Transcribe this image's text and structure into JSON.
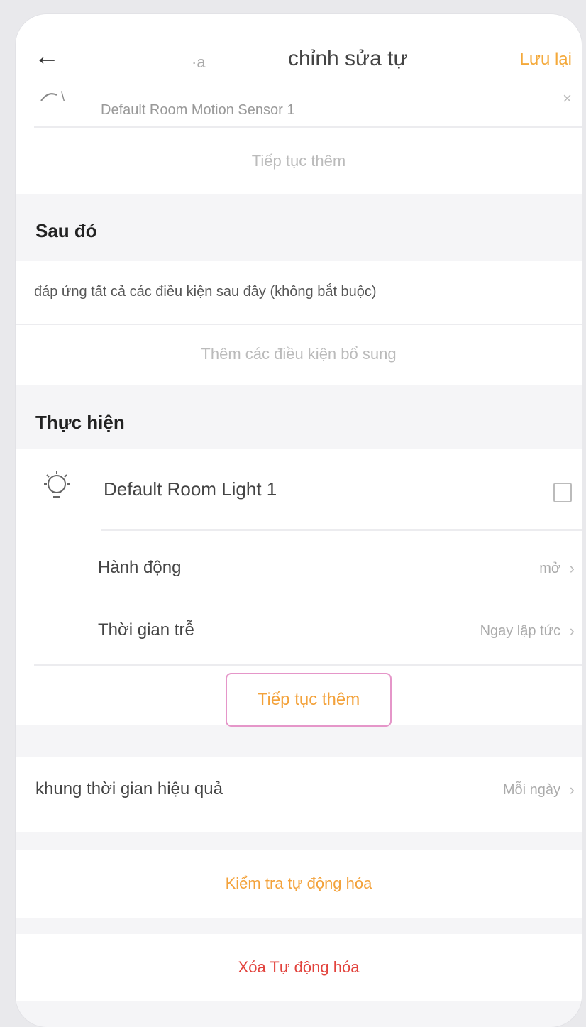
{
  "header": {
    "back_icon": "arrow-left-icon",
    "small_mark": "·a",
    "title": "chỉnh sửa tự",
    "save_label": "Lưu lại"
  },
  "trigger": {
    "device_name": "Default Room Motion Sensor 1",
    "continue_add": "Tiếp tục thêm"
  },
  "after": {
    "section_title": "Sau đó",
    "condition_text": "đáp ứng tất cả các điều kiện sau đây (không bắt buộc)",
    "add_condition": "Thêm các điều kiện bổ sung"
  },
  "execute": {
    "section_title": "Thực hiện",
    "device_name": "Default Room Light 1",
    "action_label": "Hành động",
    "action_value": "mở",
    "delay_label": "Thời gian trễ",
    "delay_value": "Ngay lập tức",
    "continue_add": "Tiếp tục thêm"
  },
  "effective": {
    "label": "khung thời gian hiệu quả",
    "value": "Mỗi ngày"
  },
  "actions": {
    "check_label": "Kiểm tra tự động hóa",
    "delete_label": "Xóa Tự động hóa"
  },
  "colors": {
    "accent": "#f3a23b",
    "danger": "#e2433d",
    "highlight_border": "#e596c9"
  }
}
